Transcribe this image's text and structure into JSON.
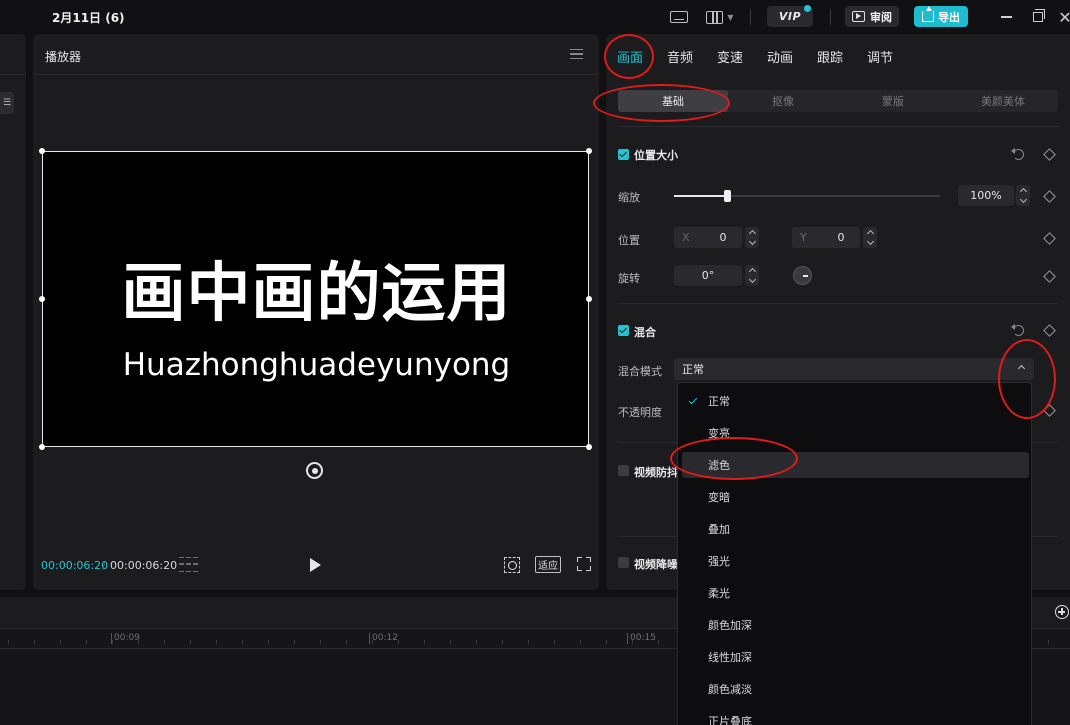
{
  "titlebar": {
    "project_title": "2月11日 (6)",
    "vip_label": "VIP",
    "review_label": "审阅",
    "export_label": "导出",
    "close_glyph": "✕"
  },
  "colors": {
    "accent": "#22c3d3",
    "annotation": "#e01b1b",
    "panel": "#1c1c1f"
  },
  "player": {
    "title": "播放器",
    "video_title": "画中画的运用",
    "video_subtitle": "Huazhonghuadeyunyong",
    "time_current": "00:00:06:20",
    "time_separator": "/",
    "time_total": "00:00:06:20",
    "fit_label": "适应"
  },
  "inspector": {
    "tabs": [
      {
        "label": "画面",
        "active": true
      },
      {
        "label": "音频"
      },
      {
        "label": "变速"
      },
      {
        "label": "动画"
      },
      {
        "label": "跟踪"
      },
      {
        "label": "调节"
      }
    ],
    "subtabs": [
      {
        "label": "基础",
        "active": true
      },
      {
        "label": "抠像"
      },
      {
        "label": "蒙版"
      },
      {
        "label": "美颜美体"
      }
    ],
    "position_size": {
      "title": "位置大小",
      "enabled": true,
      "scale_label": "缩放",
      "scale_value": "100%",
      "scale_fraction": 0.2,
      "position_label": "位置",
      "x_prefix": "X",
      "x_value": "0",
      "y_prefix": "Y",
      "y_value": "0",
      "rotate_label": "旋转",
      "rotate_value": "0°"
    },
    "blend": {
      "title": "混合",
      "enabled": true,
      "mode_label": "混合模式",
      "mode_value": "正常",
      "opacity_label": "不透明度"
    },
    "stabilize": {
      "title": "视频防抖",
      "enabled": false
    },
    "denoise": {
      "title": "视频降噪",
      "enabled": false
    }
  },
  "blend_dropdown": {
    "options": [
      "正常",
      "变亮",
      "滤色",
      "变暗",
      "叠加",
      "强光",
      "柔光",
      "颜色加深",
      "线性加深",
      "颜色减淡",
      "正片叠底"
    ],
    "selected": "正常",
    "hovered": "滤色"
  },
  "timeline": {
    "ticks": [
      "00:09",
      "00:12",
      "00:15"
    ]
  }
}
